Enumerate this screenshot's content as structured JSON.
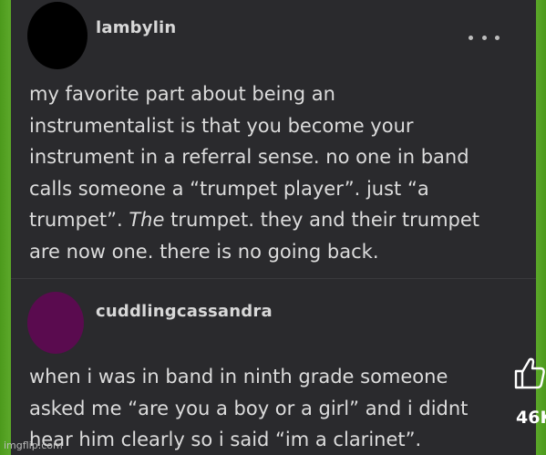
{
  "post1": {
    "username": "lambylin",
    "lines": [
      [
        "my favorite part about being an"
      ],
      [
        "instrumentalist is that you become your"
      ],
      [
        "instrument in a referral sense. no one in band"
      ],
      [
        "calls someone a “trumpet player”. just “a"
      ],
      [
        "trumpet”. ",
        "The",
        " trumpet. they and their trumpet"
      ],
      [
        "are now one. there is no going back."
      ]
    ]
  },
  "post2": {
    "username": "cuddlingcassandra",
    "lines": [
      "when i was in band in ninth grade someone",
      "asked me “are you a boy or a girl” and i didnt",
      "hear him clearly so i said “im a clarinet”."
    ]
  },
  "more_icon": "more-dots-icon",
  "like": {
    "icon": "thumbs-up-icon",
    "count": "46K"
  },
  "watermark": "imgflip.com",
  "colors": {
    "background_green": "#5aa628",
    "card": "#2a2a2d",
    "text": "#dcdcdc",
    "avatar2": "#5a0b4f"
  }
}
